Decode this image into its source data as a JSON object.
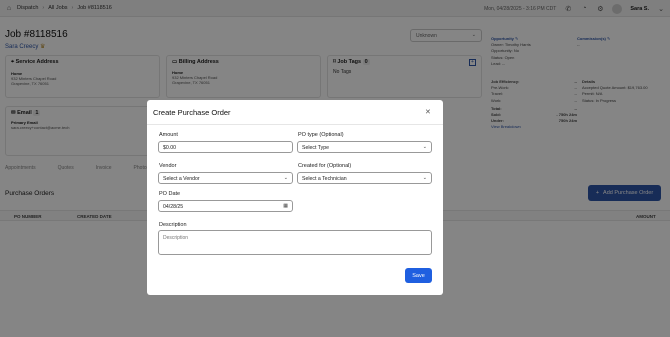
{
  "topbar": {
    "crumbs": [
      "Dispatch",
      "All Jobs",
      "Job #8118516"
    ],
    "datetime": "Mon, 04/28/2025 - 3:16 PM CDT",
    "user": "Sara S."
  },
  "job": {
    "title": "Job #8118516",
    "customer": "Sara Creecy",
    "status_select": "Unknown"
  },
  "service_address": {
    "title": "Service Address",
    "type": "Home",
    "line1": "932 Minters Chapel Road",
    "line2": "Grapevine, TX 76051"
  },
  "billing_address": {
    "title": "Billing Address",
    "type": "Home",
    "line1": "932 Minters Chapel Road",
    "line2": "Grapevine, TX 76051"
  },
  "job_tags": {
    "title": "Job Tags",
    "count": "0",
    "empty": "No Tags"
  },
  "email": {
    "title": "Email",
    "count": "1",
    "label": "Primary Email",
    "value": "sara.creecy+contact@acme.tech"
  },
  "opportunity": {
    "title": "Opportunity",
    "owner": "Owner: Timothy Harris",
    "opportunity": "Opportunity: No",
    "status": "Status: Open",
    "lead": "Lead: --"
  },
  "commissions": {
    "title": "Commission(s)",
    "value": "--"
  },
  "efficiency": {
    "rows": [
      {
        "label": "Job Efficiency:",
        "value": "--"
      },
      {
        "label": "Pre-Work:",
        "value": "--"
      },
      {
        "label": "Travel:",
        "value": "--"
      },
      {
        "label": "Work:",
        "value": "--"
      },
      {
        "label": "Total:",
        "value": "--"
      },
      {
        "label": "Sold:",
        "value": "- 750h 24m"
      },
      {
        "label": "Under:",
        "value": "750h 24m"
      }
    ],
    "breakdown": "View Breakdown"
  },
  "details": {
    "title": "Details",
    "quote": "Accepted Quote Amount: $19,763.00",
    "permit": "Permit: N/A",
    "status": "Status: In Progress"
  },
  "tabs": [
    "Appointments",
    "Quotes",
    "Invoice",
    "Photos"
  ],
  "purchase_orders": {
    "title": "Purchase Orders",
    "add_button": "Add Purchase Order",
    "columns": [
      "PO NUMBER",
      "CREATED DATE",
      "AMOUNT"
    ]
  },
  "modal": {
    "title": "Create Purchase Order",
    "amount_label": "Amount",
    "amount_value": "$0.00",
    "po_type_label": "PO type (Optional)",
    "po_type_value": "Select Type",
    "vendor_label": "Vendor",
    "vendor_value": "Select a Vendor",
    "created_for_label": "Created for (Optional)",
    "created_for_value": "Select a Technician",
    "po_date_label": "PO Date",
    "po_date_value": "04/28/25",
    "description_label": "Description",
    "description_placeholder": "Description",
    "save_label": "Save"
  },
  "colors": {
    "primary": "#1f5fe0",
    "link": "#2d55a7",
    "overlay": "rgba(0,0,0,0.48)"
  }
}
